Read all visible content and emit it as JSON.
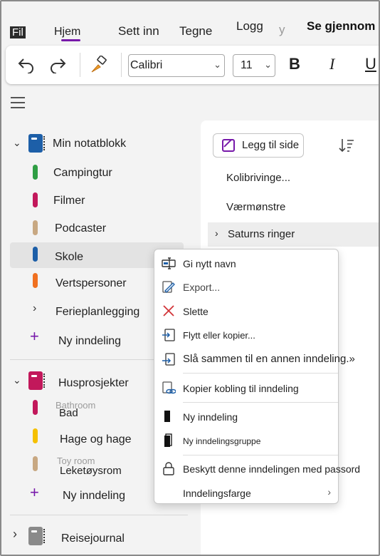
{
  "menu": {
    "tabs": [
      "Fil",
      "Hjem",
      "Sett inn",
      "Tegne",
      "Logg",
      "y",
      "Se gjennom"
    ],
    "active": "Hjem"
  },
  "toolbar": {
    "font_name": "Calibri",
    "font_size": "11",
    "bold": "B",
    "italic": "I",
    "underline": "U"
  },
  "notebooks": [
    {
      "name": "Min notatblokk",
      "color": "#1d5fa8",
      "sections": [
        {
          "name": "Campingtur",
          "color": "#2f9e44"
        },
        {
          "name": "Filmer",
          "color": "#c2185b"
        },
        {
          "name": "Podcaster",
          "color": "#c8a882"
        },
        {
          "name": "Skole",
          "color": "#1d5fa8"
        },
        {
          "name": "Vertspersoner",
          "color": "#f07020"
        },
        {
          "name": "Ferieplanlegging",
          "color": ""
        }
      ],
      "new_section": "Ny inndeling"
    },
    {
      "name": "Husprosjekter",
      "color": "#c2185b",
      "sections": [
        {
          "name": "Bad",
          "color": "#c2185b"
        },
        {
          "name": "Hage og hage",
          "color": "#f5c000"
        },
        {
          "name": "Leketøysrom",
          "color": "#c8a882"
        }
      ],
      "new_section": "Ny inndeling"
    },
    {
      "name": "Reisejournal",
      "color": "#8a8a8a"
    }
  ],
  "ghost_text": {
    "bathroom": "Bathroom",
    "toy_room": "Toy room"
  },
  "pages": {
    "add_page": "Legg til side",
    "items": [
      "Kolibrivinge...",
      "Værmønstre",
      "Saturns ringer"
    ]
  },
  "context_menu": {
    "items": [
      "Gi nytt navn",
      "Export...",
      "Slette",
      "Flytt eller kopier...",
      "Slå sammen til en annen inndeling.»",
      "Kopier kobling til inndeling",
      "Ny inndeling",
      "Ny inndelingsgruppe",
      "Beskytt denne inndelingen med passord",
      "Inndelingsfarge"
    ]
  },
  "colors": {
    "accent": "#7719aa",
    "delete_red": "#d13438"
  }
}
